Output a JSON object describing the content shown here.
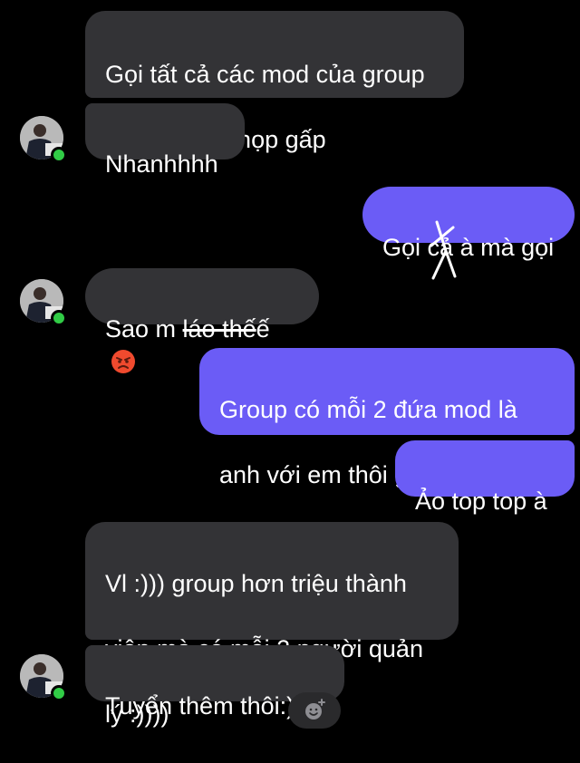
{
  "messages": {
    "m1": {
      "line1": "Gọi tất cả các mod của group",
      "line2": "BTDDL vào họp gấp"
    },
    "m2": {
      "text": "Nhanhhhh"
    },
    "m3": {
      "before": "Gọi ",
      "scribble": "cả",
      "after": " à mà gọi"
    },
    "m4": {
      "before": "Sao m ",
      "struck": "láo thế",
      "after": "ế",
      "emoji": "angry-face-emoji"
    },
    "m5": {
      "line1": "Group có mỗi 2 đứa mod là",
      "line2": "anh với em thôi gọi ai bây giờ"
    },
    "m6": {
      "text": "Ảo top top à"
    },
    "m7": {
      "line1": "Vl :))) group hơn triệu thành",
      "line2": "viên mà có mỗi 2 người quản",
      "line3": "lý :))))"
    },
    "m8": {
      "text": "Tuyển thêm thôi:)))"
    }
  },
  "colors": {
    "background": "#000000",
    "incoming_bubble": "#333336",
    "outgoing_bubble": "#6b5cf6",
    "online_dot": "#31cc46",
    "emoji_fill": "#f04a2e"
  },
  "icons": {
    "add_reaction": "add-reaction-icon",
    "avatar": "user-avatar"
  }
}
